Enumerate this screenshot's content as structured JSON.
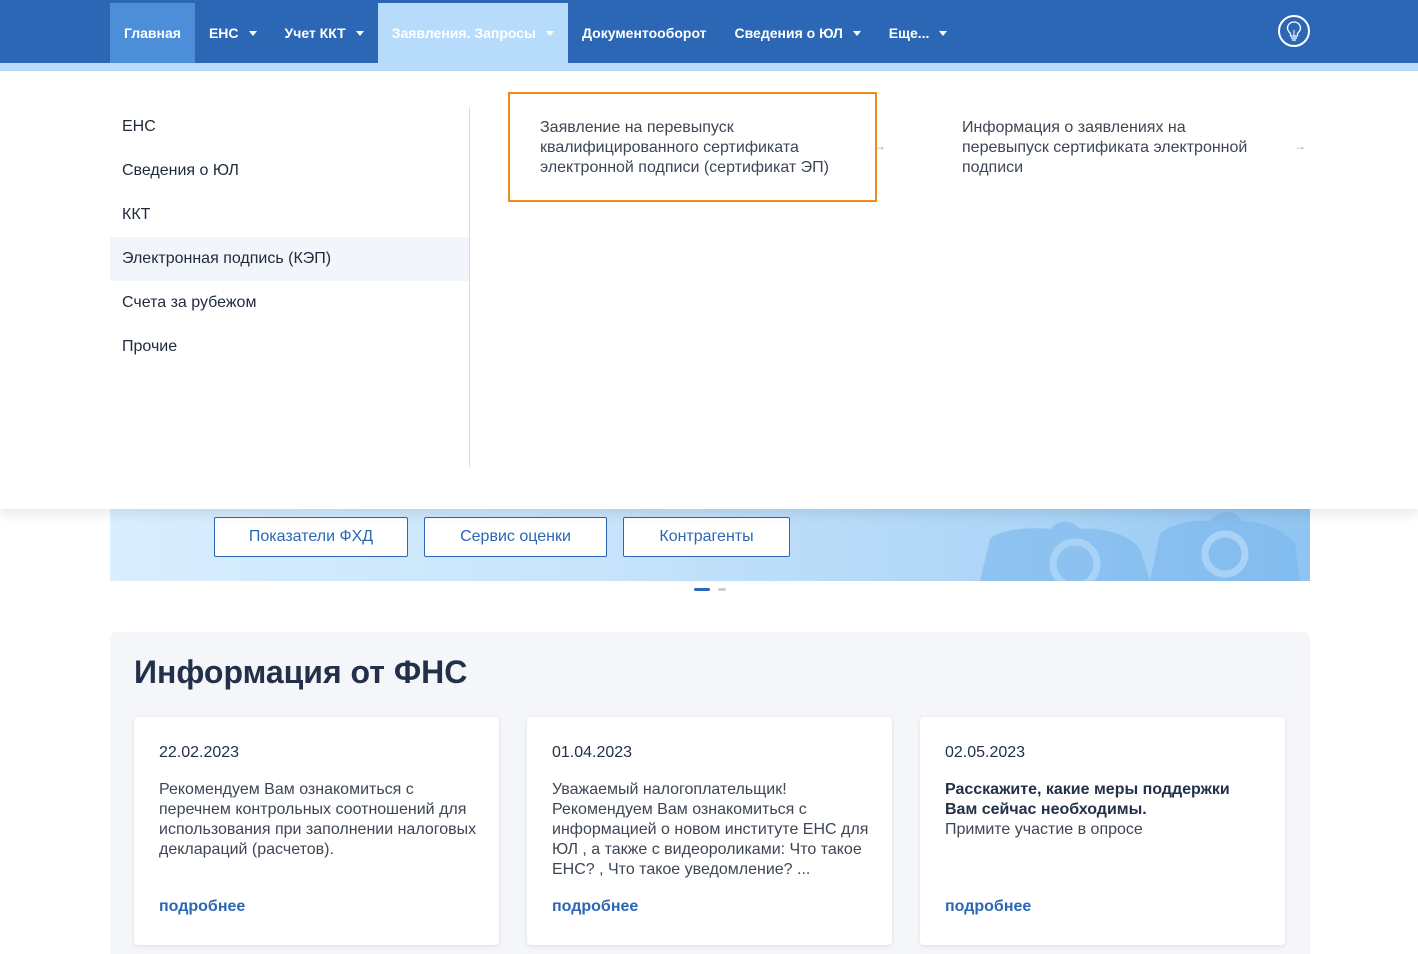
{
  "nav": {
    "items": [
      {
        "label": "Главная"
      },
      {
        "label": "ЕНС"
      },
      {
        "label": "Учет ККТ"
      },
      {
        "label": "Заявления. Запросы"
      },
      {
        "label": "Документооборот"
      },
      {
        "label": "Сведения о ЮЛ"
      },
      {
        "label": "Еще..."
      }
    ]
  },
  "dropdown": {
    "categories": [
      "ЕНС",
      "Сведения о ЮЛ",
      "ККТ",
      "Электронная подпись (КЭП)",
      "Счета за рубежом",
      "Прочие"
    ],
    "links": [
      "Заявление на перевыпуск квалифицированного сертификата электронной подписи (сертификат ЭП)",
      "Информация о заявлениях на перевыпуск сертификата электронной подписи"
    ],
    "arrow": "→"
  },
  "banner": {
    "buttons": [
      "Показатели ФХД",
      "Сервис оценки",
      "Контрагенты"
    ]
  },
  "info": {
    "title": "Информация от ФНС",
    "cards": [
      {
        "date": "22.02.2023",
        "text": "Рекомендуем Вам ознакомиться с перечнем контрольных соотношений для использования при заполнении налоговых деклараций (расчетов).",
        "link": "подробнее"
      },
      {
        "date": "01.04.2023",
        "text": "Уважаемый налогоплательщик! Рекомендуем Вам ознакомиться с информацией о новом институте ЕНС для ЮЛ , а также с видеороликами:  Что такое ЕНС? ,  Что такое уведомление? ...",
        "link": "подробнее"
      },
      {
        "date": "02.05.2023",
        "bold": "Расскажите, какие меры поддержки Вам сейчас необходимы.",
        "text": "Примите участие в опросе",
        "link": "подробнее"
      }
    ]
  },
  "colors": {
    "nav": "#2b67b5",
    "highlight": "#f18a1c",
    "link": "#2b67b5"
  },
  "icons": [
    "caret-down-icon",
    "lightbulb-icon",
    "arrow-right-icon"
  ]
}
